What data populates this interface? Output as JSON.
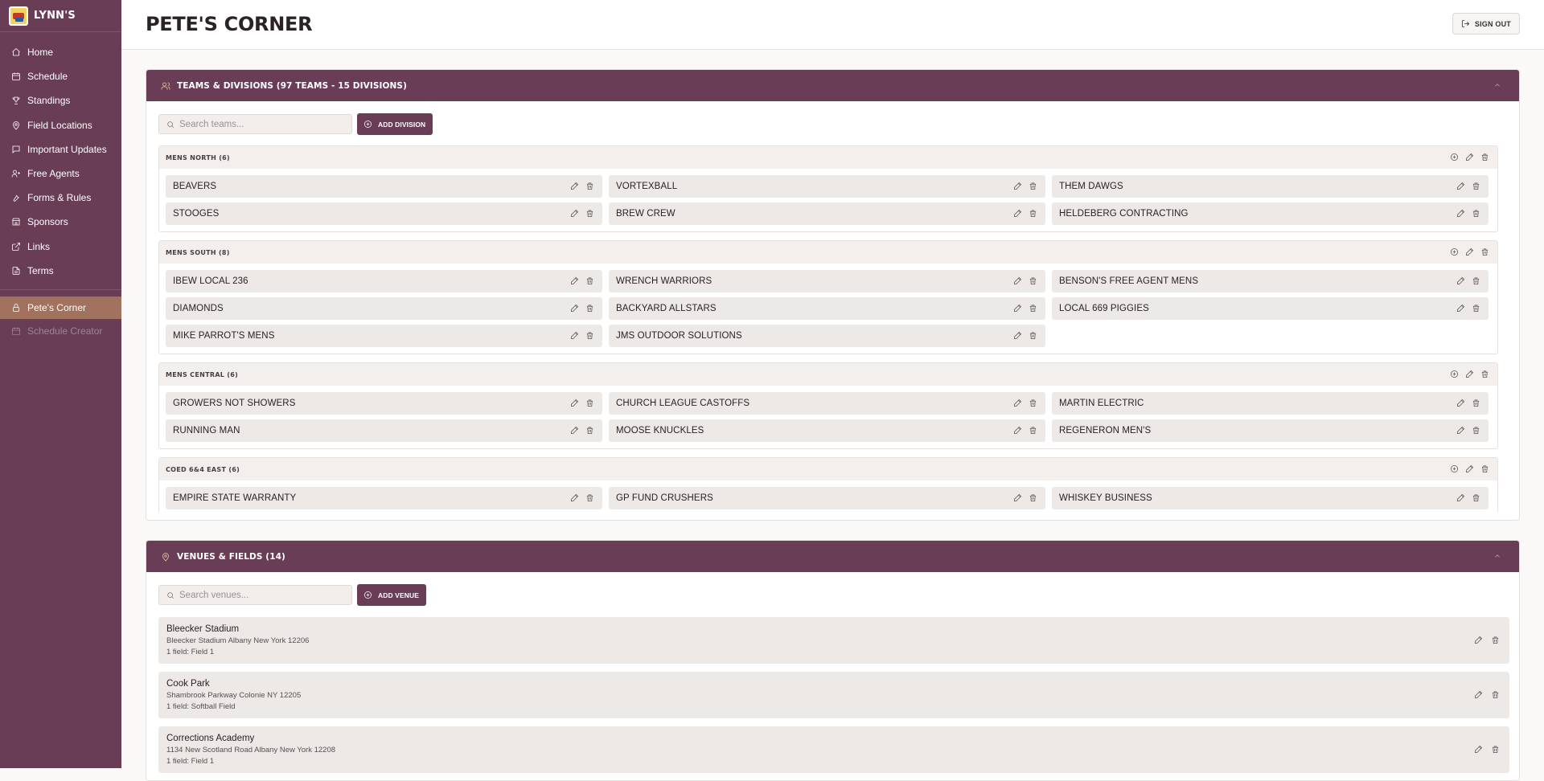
{
  "brand": {
    "name": "LYNN'S"
  },
  "nav": {
    "items": [
      {
        "label": "Home",
        "icon": "home-icon"
      },
      {
        "label": "Schedule",
        "icon": "calendar-icon"
      },
      {
        "label": "Standings",
        "icon": "trophy-icon"
      },
      {
        "label": "Field Locations",
        "icon": "map-pin-icon"
      },
      {
        "label": "Important Updates",
        "icon": "message-icon"
      },
      {
        "label": "Free Agents",
        "icon": "user-plus-icon"
      },
      {
        "label": "Forms & Rules",
        "icon": "wrench-icon"
      },
      {
        "label": "Sponsors",
        "icon": "store-icon"
      },
      {
        "label": "Links",
        "icon": "external-link-icon"
      },
      {
        "label": "Terms",
        "icon": "document-icon"
      }
    ],
    "active": {
      "label": "Pete's Corner",
      "icon": "lock-icon"
    },
    "disabled": {
      "label": "Schedule Creator",
      "icon": "calendar-icon"
    }
  },
  "header": {
    "title": "PETE'S CORNER",
    "signout_label": "SIGN OUT"
  },
  "teams_panel": {
    "title": "TEAMS & DIVISIONS (97 TEAMS - 15 DIVISIONS)",
    "search_placeholder": "Search teams...",
    "add_label": "ADD DIVISION",
    "divisions": [
      {
        "name": "MENS NORTH (6)",
        "teams": [
          "BEAVERS",
          "VORTEXBALL",
          "THEM DAWGS",
          "STOOGES",
          "BREW CREW",
          "HELDEBERG CONTRACTING"
        ]
      },
      {
        "name": "MENS SOUTH (8)",
        "teams": [
          "IBEW LOCAL 236",
          "WRENCH WARRIORS",
          "BENSON'S FREE AGENT MENS",
          "DIAMONDS",
          "BACKYARD ALLSTARS",
          "LOCAL 669 PIGGIES",
          "MIKE PARROT'S MENS",
          "JMS OUTDOOR SOLUTIONS"
        ]
      },
      {
        "name": "MENS CENTRAL (6)",
        "teams": [
          "GROWERS NOT SHOWERS",
          "CHURCH LEAGUE CASTOFFS",
          "MARTIN ELECTRIC",
          "RUNNING MAN",
          "MOOSE KNUCKLES",
          "REGENERON MEN'S"
        ]
      },
      {
        "name": "COED 6&4 EAST (6)",
        "teams": [
          "EMPIRE STATE WARRANTY",
          "GP FUND CRUSHERS",
          "WHISKEY BUSINESS"
        ]
      }
    ]
  },
  "venues_panel": {
    "title": "VENUES & FIELDS (14)",
    "search_placeholder": "Search venues...",
    "add_label": "ADD VENUE",
    "venues": [
      {
        "name": "Bleecker Stadium",
        "address": "Bleecker Stadium Albany New York 12206",
        "fields": "1 field: Field 1"
      },
      {
        "name": "Cook Park",
        "address": "Shambrook Parkway Colonie NY 12205",
        "fields": "1 field: Softball Field"
      },
      {
        "name": "Corrections Academy",
        "address": "1134 New Scotland Road Albany New York 12208",
        "fields": "1 field: Field 1"
      }
    ]
  }
}
